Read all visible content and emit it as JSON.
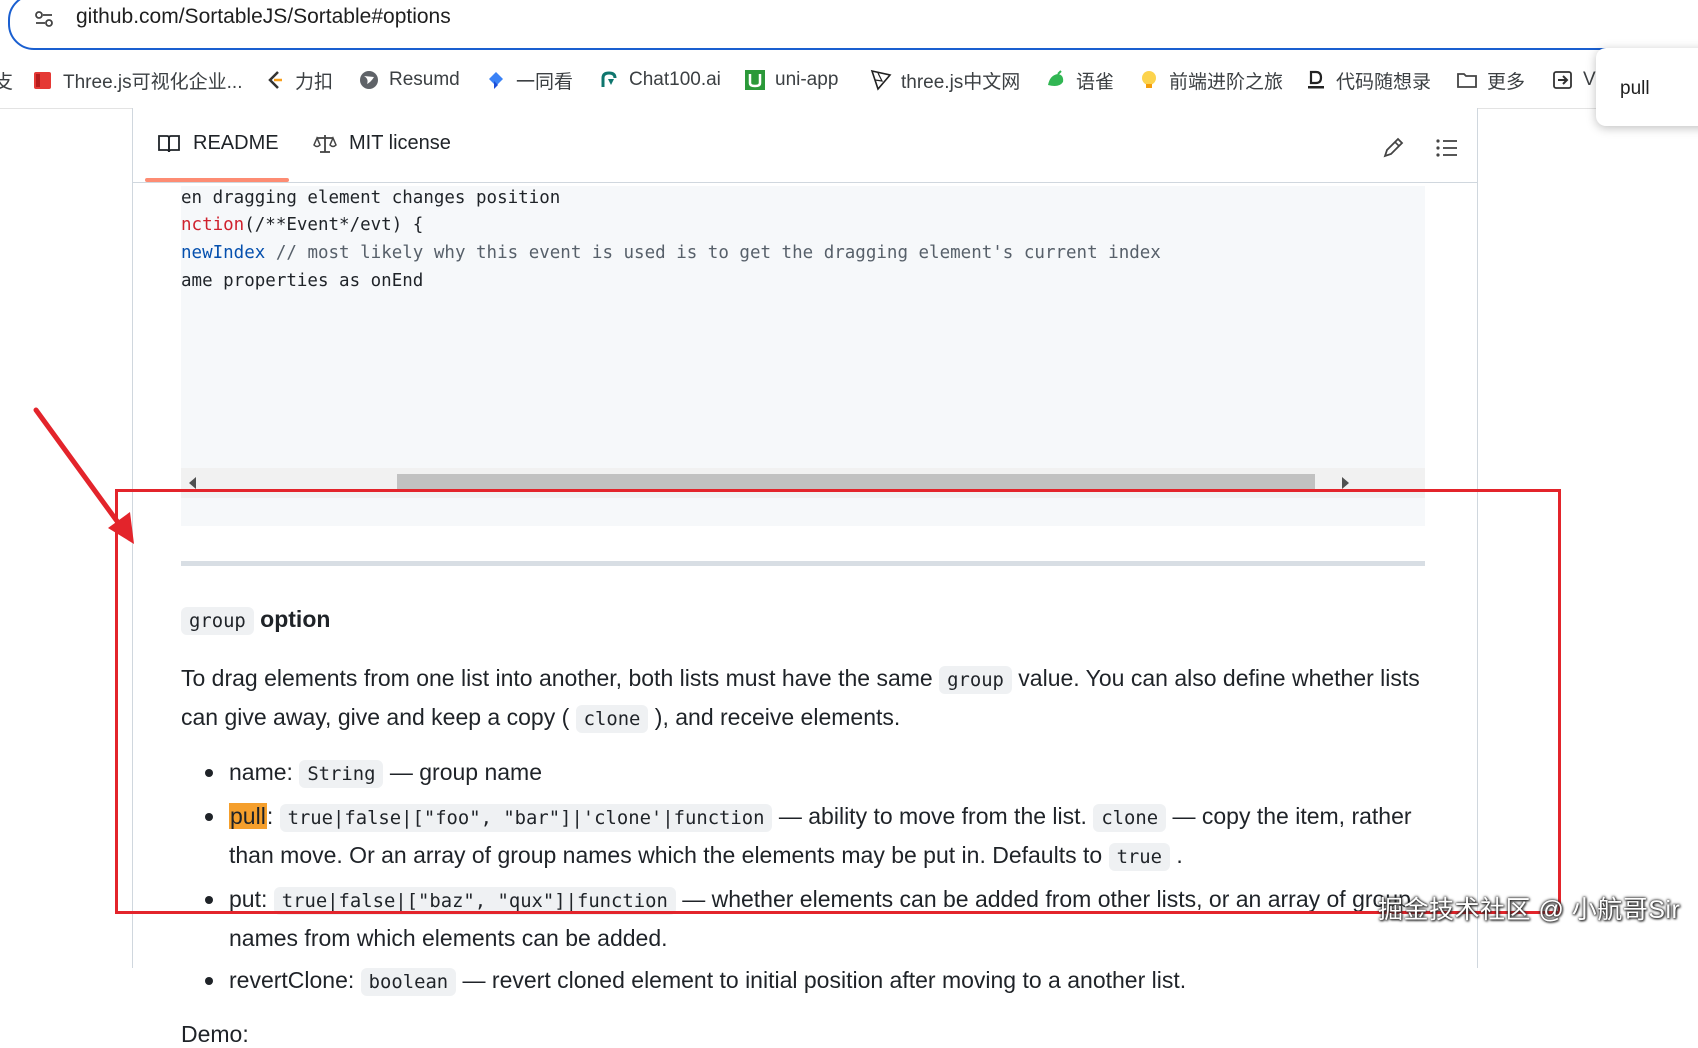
{
  "browser": {
    "url": "github.com/SortableJS/Sortable#options",
    "bookmarks": [
      {
        "label": "攴",
        "icon": "bookmark-fragment-icon"
      },
      {
        "label": "Three.js可视化企业...",
        "icon": "red-book-icon"
      },
      {
        "label": "力扣",
        "icon": "leetcode-icon"
      },
      {
        "label": "Resumd",
        "icon": "globe-icon"
      },
      {
        "label": "一同看",
        "icon": "blue-app-icon"
      },
      {
        "label": "Chat100.ai",
        "icon": "chat-logo-icon"
      },
      {
        "label": "uni-app",
        "icon": "uniapp-icon"
      },
      {
        "label": "three.js中文网",
        "icon": "threejs-icon"
      },
      {
        "label": "语雀",
        "icon": "yuque-icon"
      },
      {
        "label": "前端进阶之旅",
        "icon": "bulb-icon"
      },
      {
        "label": "代码随想录",
        "icon": "download-icon"
      },
      {
        "label": "更多",
        "icon": "folder-icon"
      },
      {
        "label": "V",
        "icon": "login-icon"
      }
    ],
    "find_popup": "pull"
  },
  "readme": {
    "tabs": [
      "README",
      "MIT license"
    ],
    "code_lines": {
      "l1": "en dragging element changes position",
      "l2_kw": "nction",
      "l2_rest": "(/**Event*/evt) {",
      "l3_kw": "newIndex",
      "l3_comment": " // most likely why this event is used is to get the dragging element's current index",
      "l4": "ame properties as onEnd"
    },
    "heading_code": "group",
    "heading_text": " option",
    "para": {
      "t1": "To drag elements from one list into another, both lists must have the same ",
      "c1": "group",
      "t2": " value. You can also define whether lists can give away, give and keep a copy ( ",
      "c2": "clone",
      "t3": " ), and receive elements."
    },
    "items": {
      "name": {
        "key": "name: ",
        "code": "String",
        "text": " — group name"
      },
      "pull": {
        "key": "pull",
        "colon": ": ",
        "code": "true|false|[\"foo\", \"bar\"]|'clone'|function",
        "t1": " — ability to move from the list. ",
        "code2": "clone",
        "t2": " — copy the item, rather than move. Or an array of group names which the elements may be put in. Defaults to ",
        "code3": "true",
        "t3": " ."
      },
      "put": {
        "key": "put: ",
        "code": "true|false|[\"baz\", \"qux\"]|function",
        "text": " — whether elements can be added from other lists, or an array of group names from which elements can be added."
      },
      "revert": {
        "key": "revertClone: ",
        "code": "boolean",
        "text": " — revert cloned element to initial position after moving to a another list."
      }
    },
    "demo": "Demo:"
  },
  "watermark": "掘金技术社区 @ 小航哥Sir",
  "colors": {
    "annotation": "#e3242b",
    "highlight": "#f59f2c",
    "tab_underline": "#fd8c73",
    "address_border": "#1a5fd0"
  }
}
